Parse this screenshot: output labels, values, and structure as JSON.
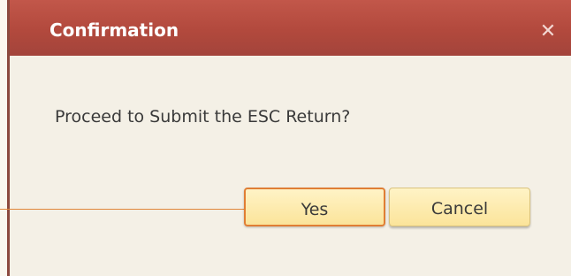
{
  "dialog": {
    "title": "Confirmation",
    "close_icon": "close-icon",
    "message": "Proceed to Submit the ESC Return?",
    "buttons": {
      "yes": "Yes",
      "cancel": "Cancel"
    }
  },
  "colors": {
    "titlebar": "#b2493d",
    "body": "#f4f0e6",
    "button": "#fbe49a",
    "focus_border": "#e07e34"
  }
}
